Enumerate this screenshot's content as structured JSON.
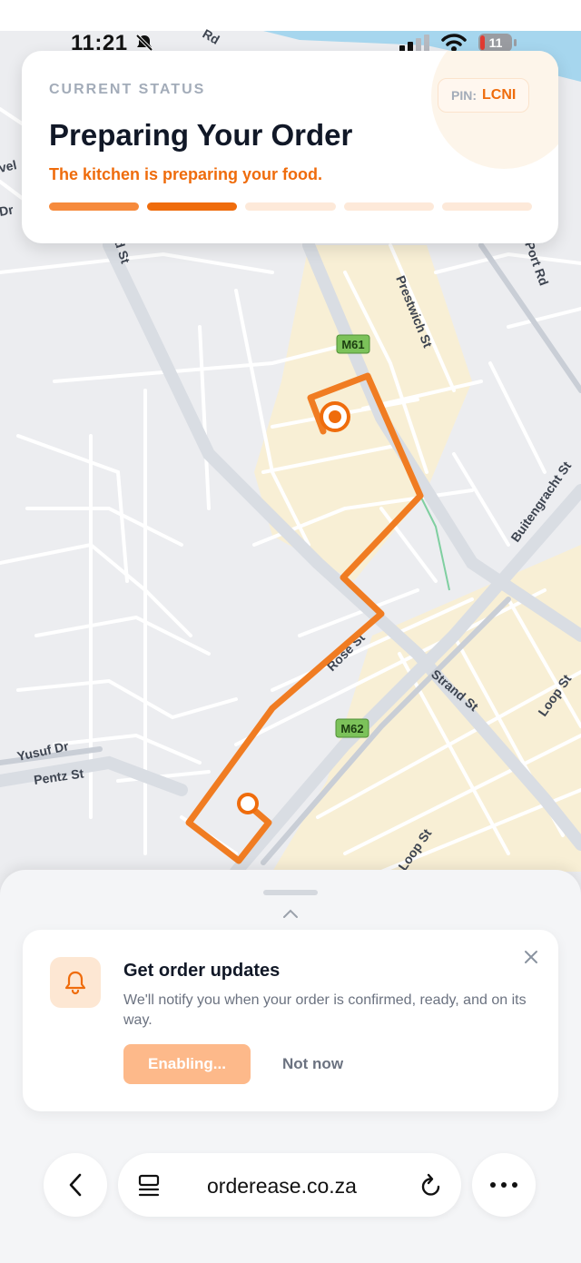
{
  "status_bar": {
    "time": "11:21",
    "battery": "11"
  },
  "map": {
    "streets": [
      "Prestwich St",
      "Port Rd",
      "Buitengracht St",
      "Strand St",
      "Loop St",
      "Loop St",
      "Rose St",
      "Yusuf Dr",
      "Pentz St",
      "Rd",
      "vel",
      "Dr",
      "d St"
    ],
    "shields": [
      "M61",
      "M62"
    ]
  },
  "status_card": {
    "label": "CURRENT STATUS",
    "pin_label": "PIN:",
    "pin_code": "LCNI",
    "title": "Preparing Your Order",
    "subtitle": "The kitchen is preparing your food.",
    "progress": {
      "completed_steps": 2,
      "total_steps": 5
    },
    "colors": {
      "accent": "#ef6c0c",
      "done": "#f68a3c",
      "active": "#ef6c0c",
      "pending": "#fde9d9"
    }
  },
  "notification": {
    "title": "Get order updates",
    "description": "We'll notify you when your order is confirmed, ready, and on its way.",
    "enable_label": "Enabling...",
    "dismiss_label": "Not now"
  },
  "browser": {
    "url": "orderease.co.za"
  }
}
